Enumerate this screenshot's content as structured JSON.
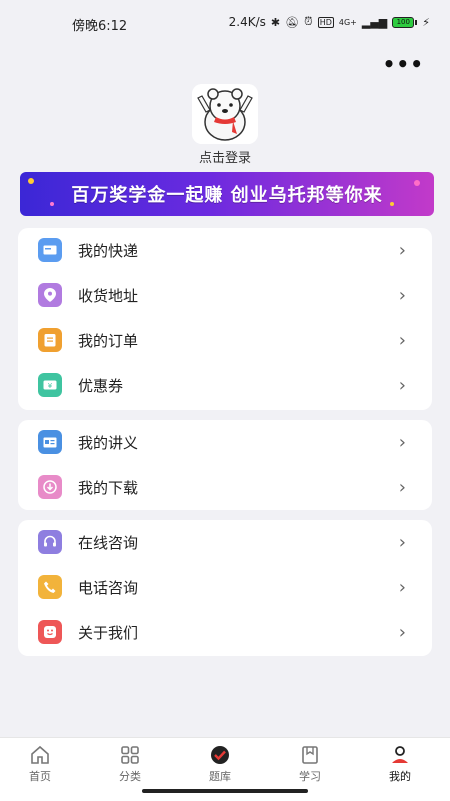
{
  "status_bar": {
    "time": "傍晚6:12",
    "network_speed": "2.4K/s",
    "signal": "4G+",
    "battery": "100"
  },
  "header": {
    "more_icon": "more-dots-icon"
  },
  "profile": {
    "login_label": "点击登录",
    "avatar_icon": "polar-bear-avatar"
  },
  "banner": {
    "text": "百万奖学金一起赚  创业乌托邦等你来"
  },
  "section1": [
    {
      "label": "我的快递",
      "icon": "express-icon",
      "color": "#5b9cf0"
    },
    {
      "label": "收货地址",
      "icon": "location-icon",
      "color": "#b17be0"
    },
    {
      "label": "我的订单",
      "icon": "order-icon",
      "color": "#f0a030"
    },
    {
      "label": "优惠券",
      "icon": "coupon-icon",
      "color": "#3fc4a0"
    }
  ],
  "section2": [
    {
      "label": "我的讲义",
      "icon": "handout-icon",
      "color": "#4a90e2"
    },
    {
      "label": "我的下载",
      "icon": "download-icon",
      "color": "#e88bc8"
    }
  ],
  "section3": [
    {
      "label": "在线咨询",
      "icon": "headset-icon",
      "color": "#8e7ee0"
    },
    {
      "label": "电话咨询",
      "icon": "phone-icon",
      "color": "#f2b33b"
    },
    {
      "label": "关于我们",
      "icon": "smile-icon",
      "color": "#ee5757"
    }
  ],
  "tabbar": [
    {
      "label": "首页",
      "icon": "home-icon",
      "active": false
    },
    {
      "label": "分类",
      "icon": "grid-icon",
      "active": false
    },
    {
      "label": "题库",
      "icon": "quiz-bank-icon",
      "active": false
    },
    {
      "label": "学习",
      "icon": "bookmark-icon",
      "active": false
    },
    {
      "label": "我的",
      "icon": "profile-icon",
      "active": true
    }
  ]
}
